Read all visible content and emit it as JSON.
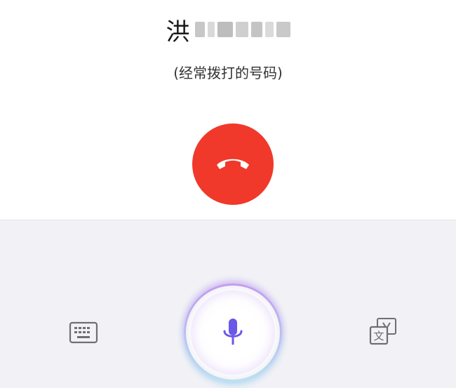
{
  "call": {
    "caller_name_visible": "洪",
    "caller_note": "(经常拨打的号码)",
    "mask_blocks": [
      {
        "w": 14,
        "shade": "#c7c7c7"
      },
      {
        "w": 10,
        "shade": "#d9d9d9"
      },
      {
        "w": 22,
        "shade": "#bdbdbd"
      },
      {
        "w": 18,
        "shade": "#cfcfcf"
      },
      {
        "w": 16,
        "shade": "#c4c4c4"
      },
      {
        "w": 12,
        "shade": "#dadada"
      },
      {
        "w": 20,
        "shade": "#c9c9c9"
      }
    ]
  },
  "colors": {
    "hangup": "#f0392b",
    "mic": "#6a58e8",
    "icon_gray": "#6e6e73"
  },
  "icons": {
    "hangup": "phone-hangup-icon",
    "keyboard": "keyboard-icon",
    "mic": "microphone-icon",
    "translate": "translate-icon"
  },
  "translate_glyph": "文"
}
